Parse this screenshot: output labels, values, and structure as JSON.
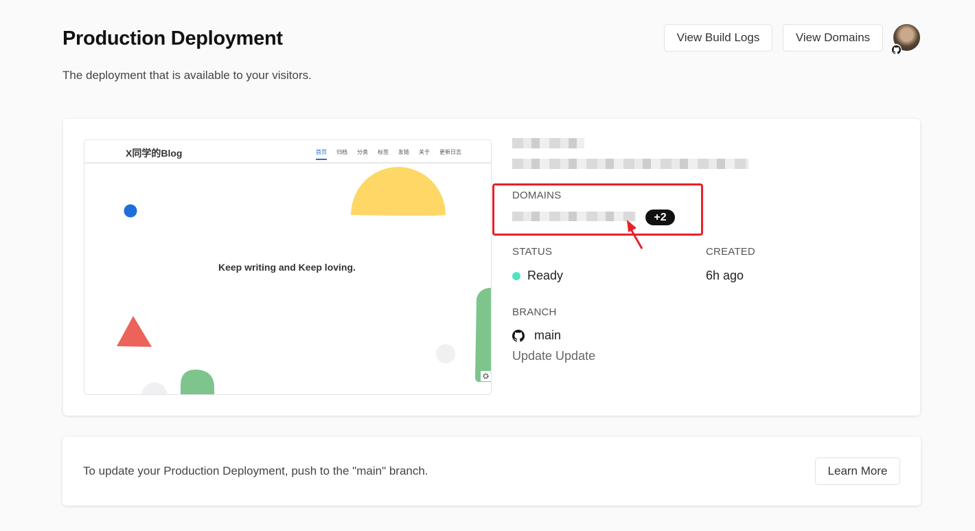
{
  "header": {
    "title": "Production Deployment",
    "subtitle": "The deployment that is available to your visitors.",
    "view_build_logs": "View Build Logs",
    "view_domains": "View Domains",
    "avatar_icon": "user-avatar",
    "badge_icon": "github-icon"
  },
  "preview": {
    "logo": "X同学的Blog",
    "menu": [
      "首页",
      "归档",
      "分类",
      "标签",
      "友链",
      "关于",
      "更新日志"
    ],
    "slogan": "Keep writing and Keep loving.",
    "colors": {
      "yellow": "#fed766",
      "blue": "#1e6fd9",
      "red": "#ec6459",
      "green": "#7dc58d",
      "gray": "#f0f0f2"
    }
  },
  "deployment": {
    "domains_label": "DOMAINS",
    "domains_extra": "+2",
    "status_label": "STATUS",
    "status_value": "Ready",
    "status_color": "#50e3c2",
    "created_label": "CREATED",
    "created_value": "6h ago",
    "branch_label": "BRANCH",
    "branch_value": "main",
    "commit_message": "Update Update",
    "annotation_color": "#e8202a"
  },
  "footer": {
    "text": "To update your Production Deployment, push to the \"main\" branch.",
    "learn_more": "Learn More"
  }
}
